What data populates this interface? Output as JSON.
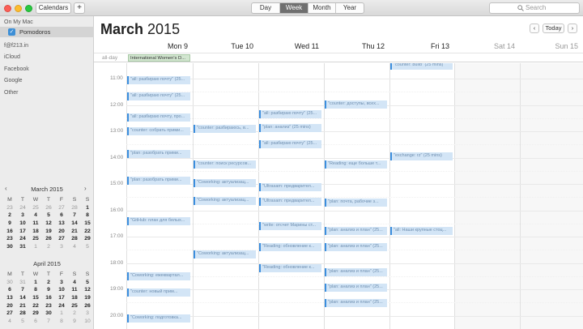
{
  "toolbar": {
    "calendars_label": "Calendars",
    "add_label": "+",
    "views": [
      "Day",
      "Week",
      "Month",
      "Year"
    ],
    "active_view": "Week",
    "search_placeholder": "Search"
  },
  "sidebar": {
    "section_on_my_mac": "On My Mac",
    "calendar_pomodoros": "Pomodoros",
    "accounts": [
      "f@f213.in",
      "iCloud",
      "Facebook",
      "Google",
      "Other"
    ]
  },
  "mini_march": {
    "title": "March 2015",
    "weekdays": [
      "M",
      "T",
      "W",
      "T",
      "F",
      "S",
      "S"
    ],
    "rows": [
      [
        "23",
        "24",
        "25",
        "26",
        "27",
        "28",
        "1"
      ],
      [
        "2",
        "3",
        "4",
        "5",
        "6",
        "7",
        "8"
      ],
      [
        "9",
        "10",
        "11",
        "12",
        "13",
        "14",
        "15"
      ],
      [
        "16",
        "17",
        "18",
        "19",
        "20",
        "21",
        "22"
      ],
      [
        "23",
        "24",
        "25",
        "26",
        "27",
        "28",
        "29"
      ],
      [
        "30",
        "31",
        "1",
        "2",
        "3",
        "4",
        "5"
      ]
    ]
  },
  "mini_april": {
    "title": "April 2015",
    "weekdays": [
      "M",
      "T",
      "W",
      "T",
      "F",
      "S",
      "S"
    ],
    "rows": [
      [
        "30",
        "31",
        "1",
        "2",
        "3",
        "4",
        "5"
      ],
      [
        "6",
        "7",
        "8",
        "9",
        "10",
        "11",
        "12"
      ],
      [
        "13",
        "14",
        "15",
        "16",
        "17",
        "18",
        "19"
      ],
      [
        "20",
        "21",
        "22",
        "23",
        "24",
        "25",
        "26"
      ],
      [
        "27",
        "28",
        "29",
        "30",
        "1",
        "2",
        "3"
      ],
      [
        "4",
        "5",
        "6",
        "7",
        "8",
        "9",
        "10"
      ]
    ]
  },
  "main": {
    "month": "March",
    "year": "2015",
    "today_label": "Today",
    "prev": "‹",
    "next": "›",
    "days": [
      "Mon 9",
      "Tue 10",
      "Wed 11",
      "Thu 12",
      "Fri 13",
      "Sat 14",
      "Sun 15"
    ],
    "allday_label": "all-day",
    "allday_event": "International Women's D...",
    "hours": [
      "11:00",
      "12:00",
      "13:00",
      "14:00",
      "15:00",
      "16:00",
      "17:00",
      "18:00",
      "19:00",
      "20:00"
    ]
  },
  "events": {
    "mon": [
      "\"all: разбираю почту\" (25...",
      "\"all: разбираю почту\" (25...",
      "\"all: разбираю почту, про...",
      "\"counter: собрать прими...",
      "\"plan: разобрать прими...",
      "\"plan: разобрать прими...",
      "\"GitHub: план для белых...",
      "\"Coworking: ежеквартал...",
      "\"counter: новый прим...",
      "\"Coworking: подготовка..."
    ],
    "tue": [
      "\"counter: разбираюсь, в...",
      "\"counter: поиск ресурсов...",
      "\"Coworking: актуализац...",
      "\"Coworking: актуализац...",
      "\"Coworking: актуализац..."
    ],
    "wed": [
      "\"all: разбираю почту\" (25...",
      "\"plan: анализ\" (25 mins)",
      "\"all: разбираю почту\" (25...",
      "\"Ultrasam: предварител...",
      "\"Ultrasam: предварител...",
      "\"write: отсчет Марины ст...",
      "\"Reading: обновление к...",
      "\"Reading: обновление к..."
    ],
    "thu": [
      "\"counter: доступы, всех...",
      "\"Reading: еще больше т...",
      "\"plan: почта, рабочие з...",
      "\"plan: анализ и план\" (25...",
      "\"plan: анализ и план\" (25...",
      "\"plan: анализ и план\" (25...",
      "\"plan: анализ и план\" (25...",
      "\"plan: анализ и план\" (25..."
    ],
    "fri": [
      "\"counter: build\" (25 mins)",
      "\"exchange: rz\" (25 mins)",
      "\"all: Наши крупные стоц..."
    ]
  }
}
